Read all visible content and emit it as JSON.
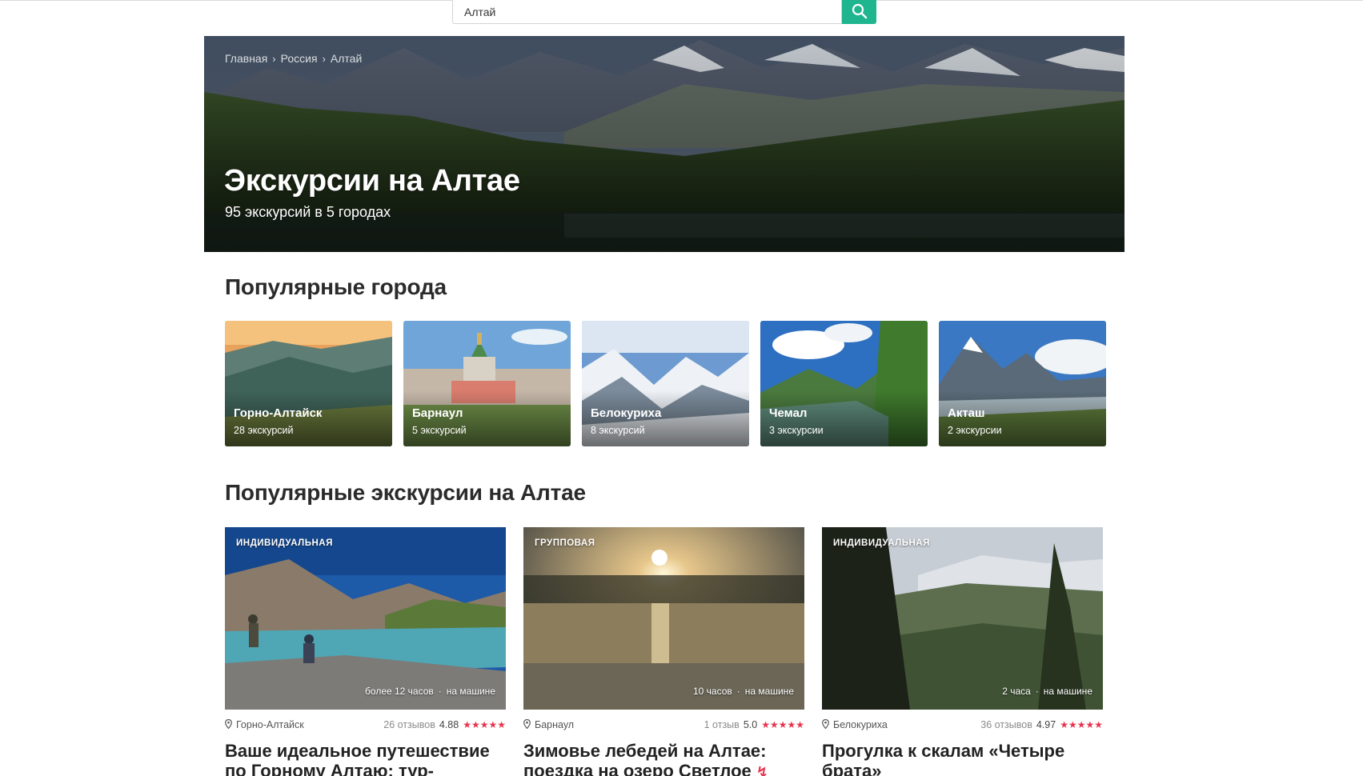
{
  "search": {
    "value": "Алтай",
    "placeholder": ""
  },
  "colors": {
    "accent": "#1fb58f",
    "star": "#e8344e"
  },
  "breadcrumb": [
    "Главная",
    "Россия",
    "Алтай"
  ],
  "hero": {
    "title": "Экскурсии на Алтае",
    "subtitle": "95 экскурсий в 5 городах"
  },
  "cities_section": {
    "title": "Популярные города",
    "items": [
      {
        "name": "Горно-Алтайск",
        "count": "28 экскурсий"
      },
      {
        "name": "Барнаул",
        "count": "5 экскурсий"
      },
      {
        "name": "Белокуриха",
        "count": "8 экскурсий"
      },
      {
        "name": "Чемал",
        "count": "3 экскурсии"
      },
      {
        "name": "Акташ",
        "count": "2 экскурсии"
      }
    ]
  },
  "tours_section": {
    "title": "Популярные экскурсии на Алтае",
    "items": [
      {
        "type": "ИНДИВИДУАЛЬНАЯ",
        "duration": "более 12 часов",
        "transport": "на машине",
        "city": "Горно-Алтайск",
        "reviews": "26 отзывов",
        "rating": "4.88",
        "stars": "★★★★★",
        "title_line1": "Ваше идеальное путешествие",
        "title_line2": "по Горному Алтаю: тур-"
      },
      {
        "type": "ГРУППОВАЯ",
        "duration": "10 часов",
        "transport": "на машине",
        "city": "Барнаул",
        "reviews": "1 отзыв",
        "rating": "5.0",
        "stars": "★★★★★",
        "title_line1": "Зимовье лебедей на Алтае:",
        "title_line2": "поездка на озеро Светлое"
      },
      {
        "type": "ИНДИВИДУАЛЬНАЯ",
        "duration": "2 часа",
        "transport": "на машине",
        "city": "Белокуриха",
        "reviews": "36 отзывов",
        "rating": "4.97",
        "stars": "★★★★★",
        "title_line1": "Прогулка к скалам «Четыре",
        "title_line2": "брата»"
      }
    ]
  },
  "meta_separator": "·",
  "icons": {
    "search": "search-icon",
    "location": "map-pin-icon",
    "bolt": "lightning-icon",
    "breadcrumb_sep": "chevron-right-icon"
  }
}
